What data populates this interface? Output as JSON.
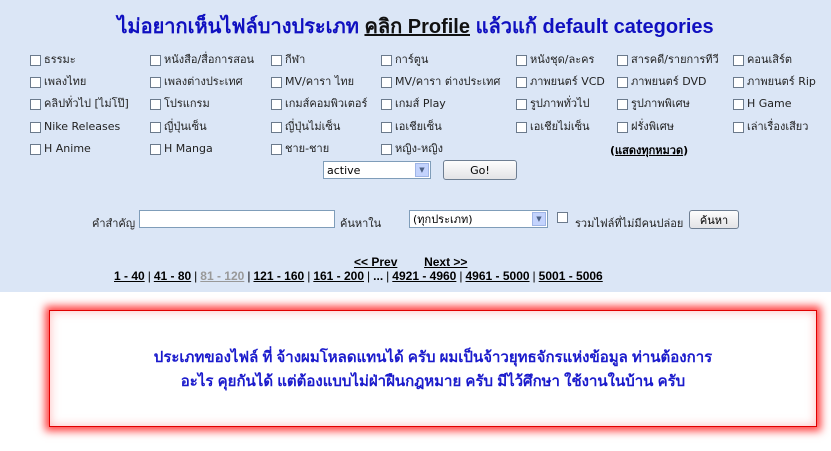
{
  "header": {
    "prefix": "ไม่อยากเห็นไฟล์บางประเภท",
    "click_text": "คลิก Profile",
    "suffix": "แล้วแก้ default categories"
  },
  "categories": {
    "columns": [
      [
        "ธรรมะ",
        "เพลงไทย",
        "คลิปทั่วไป [ไม่โป๊]",
        "Nike Releases",
        "H Anime"
      ],
      [
        "หนังสือ/สื่อการสอน",
        "เพลงต่างประเทศ",
        "โปรแกรม",
        "ญี่ปุ่นเซ็น",
        "H Manga"
      ],
      [
        "กีฬา",
        "MV/คารา ไทย",
        "เกมส์คอมพิวเตอร์",
        "ญี่ปุ่นไม่เซ็น",
        "ชาย-ชาย"
      ],
      [
        "การ์ตูน",
        "MV/คารา ต่างประเทศ",
        "เกมส์ Play",
        "เอเชียเซ็น",
        "หญิง-หญิง"
      ],
      [
        "หนังชุด/ละคร",
        "ภาพยนตร์ VCD",
        "รูปภาพทั่วไป",
        "เอเชียไม่เซ็น"
      ],
      [
        "สารคดี/รายการทีวี",
        "ภาพยนตร์ DVD",
        "รูปภาพพิเศษ",
        "ฝรั่งพิเศษ"
      ],
      [
        "คอนเสิร์ต",
        "ภาพยนตร์ Rip",
        "H Game",
        "เล่าเรื่องเสียว"
      ]
    ],
    "show_all": "แสดงทุกหมวด"
  },
  "filter": {
    "status_value": "active",
    "go_label": "Go!"
  },
  "search": {
    "keyword_label": "คำสำคัญ",
    "keyword_value": "",
    "searchin_label": "ค้นหาใน",
    "scope_value": "(ทุกประเภท)",
    "include_label": "รวมไฟล์ที่ไม่มีคนปล่อย",
    "search_button": "ค้นหา"
  },
  "pager": {
    "prev": "<< Prev",
    "next": "Next >>",
    "pages": [
      "1 - 40",
      "41 - 80",
      "81 - 120",
      "121 - 160",
      "161 - 200",
      "...",
      "4921 - 4960",
      "4961 - 5000",
      "5001 - 5006"
    ],
    "current_page": "81 - 120"
  },
  "banner": {
    "line1": "ประเภทของไฟล์ ที่ จ้างผมโหลดแทนได้ ครับ ผมเป็นจ้าวยุทธจักรแห่งข้อมูล ท่านต้องการ",
    "line2": "อะไร คุยกันได้  แต่ต้องแบบไม่ฝ่าฝืนกฎหมาย ครับ มีไว้ศึกษา ใช้งานในบ้าน ครับ"
  },
  "colors": {
    "top_background": "#dbe6f6",
    "headline_blue": "#1010c0",
    "banner_border": "#e00000",
    "banner_text": "#1a1acc"
  }
}
